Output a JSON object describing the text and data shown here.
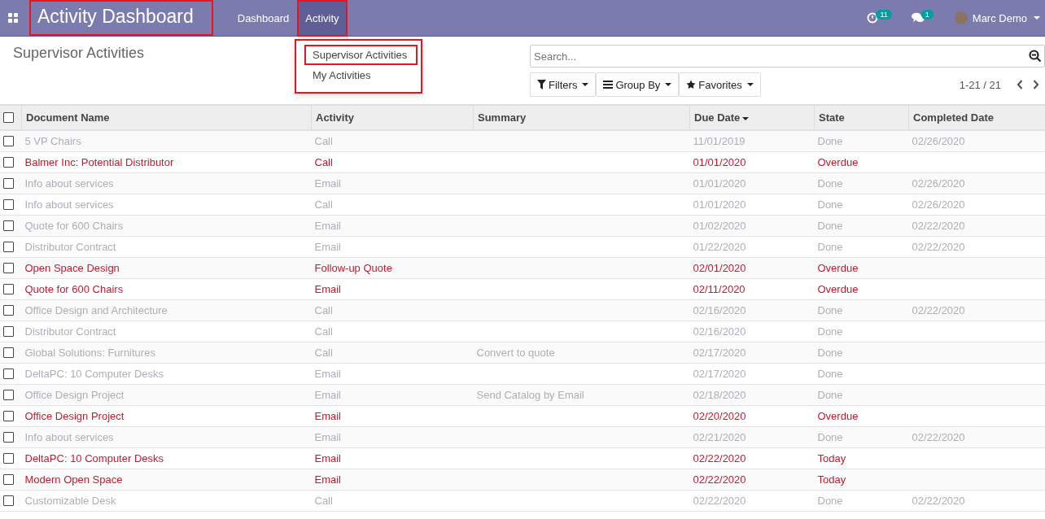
{
  "navbar": {
    "app_title": "Activity Dashboard",
    "app_title_highlighted": true,
    "menu": [
      {
        "label": "Dashboard",
        "selected": false,
        "highlighted": false
      },
      {
        "label": "Activity",
        "selected": true,
        "highlighted": true
      }
    ],
    "activity_badge": "11",
    "message_badge": "1",
    "user": "Marc Demo"
  },
  "dropdown": {
    "highlighted": true,
    "items": [
      {
        "label": "Supervisor Activities",
        "highlighted": true
      },
      {
        "label": "My Activities",
        "highlighted": false
      }
    ]
  },
  "control_panel": {
    "title": "Supervisor Activities",
    "search": {
      "placeholder": "Search..."
    },
    "buttons": [
      {
        "kind": "filter",
        "label": "Filters"
      },
      {
        "kind": "group",
        "label": "Group By"
      },
      {
        "kind": "star",
        "label": "Favorites"
      }
    ],
    "pager": "1-21 / 21"
  },
  "table": {
    "select_all_checked": false,
    "columns": [
      {
        "label": "Document Name",
        "sorted": false
      },
      {
        "label": "Activity",
        "sorted": false
      },
      {
        "label": "Summary",
        "sorted": false
      },
      {
        "label": "Due Date",
        "sorted": true
      },
      {
        "label": "State",
        "sorted": false
      },
      {
        "label": "Completed Date",
        "sorted": false
      }
    ],
    "rows": [
      {
        "kind": "done",
        "cells": [
          "5 VP Chairs",
          "Call",
          "",
          "11/01/2019",
          "Done",
          "02/26/2020"
        ]
      },
      {
        "kind": "overdue",
        "cells": [
          "Balmer Inc: Potential Distributor",
          "Call",
          "",
          "01/01/2020",
          "Overdue",
          ""
        ]
      },
      {
        "kind": "done",
        "cells": [
          "Info about services",
          "Email",
          "",
          "01/01/2020",
          "Done",
          "02/26/2020"
        ]
      },
      {
        "kind": "done",
        "cells": [
          "Info about services",
          "Call",
          "",
          "01/01/2020",
          "Done",
          "02/26/2020"
        ]
      },
      {
        "kind": "done",
        "cells": [
          "Quote for 600 Chairs",
          "Email",
          "",
          "01/02/2020",
          "Done",
          "02/22/2020"
        ]
      },
      {
        "kind": "done",
        "cells": [
          "Distributor Contract",
          "Email",
          "",
          "01/22/2020",
          "Done",
          "02/22/2020"
        ]
      },
      {
        "kind": "overdue",
        "cells": [
          "Open Space Design",
          "Follow-up Quote",
          "",
          "02/01/2020",
          "Overdue",
          ""
        ]
      },
      {
        "kind": "overdue",
        "cells": [
          "Quote for 600 Chairs",
          "Email",
          "",
          "02/11/2020",
          "Overdue",
          ""
        ]
      },
      {
        "kind": "done",
        "cells": [
          "Office Design and Architecture",
          "Call",
          "",
          "02/16/2020",
          "Done",
          "02/22/2020"
        ]
      },
      {
        "kind": "done",
        "cells": [
          "Distributor Contract",
          "Call",
          "",
          "02/16/2020",
          "Done",
          ""
        ]
      },
      {
        "kind": "done",
        "cells": [
          "Global Solutions: Furnitures",
          "Call",
          "Convert to quote",
          "02/17/2020",
          "Done",
          ""
        ]
      },
      {
        "kind": "done",
        "cells": [
          "DeltaPC: 10 Computer Desks",
          "Email",
          "",
          "02/17/2020",
          "Done",
          ""
        ]
      },
      {
        "kind": "done",
        "cells": [
          "Office Design Project",
          "Email",
          "Send Catalog by Email",
          "02/18/2020",
          "Done",
          ""
        ]
      },
      {
        "kind": "overdue",
        "cells": [
          "Office Design Project",
          "Email",
          "",
          "02/20/2020",
          "Overdue",
          ""
        ]
      },
      {
        "kind": "done",
        "cells": [
          "Info about services",
          "Email",
          "",
          "02/21/2020",
          "Done",
          "02/22/2020"
        ]
      },
      {
        "kind": "today",
        "cells": [
          "DeltaPC: 10 Computer Desks",
          "Email",
          "",
          "02/22/2020",
          "Today",
          ""
        ]
      },
      {
        "kind": "today",
        "cells": [
          "Modern Open Space",
          "Email",
          "",
          "02/22/2020",
          "Today",
          ""
        ]
      },
      {
        "kind": "done",
        "cells": [
          "Customizable Desk",
          "Call",
          "",
          "02/22/2020",
          "Done",
          "02/22/2020"
        ]
      }
    ]
  }
}
